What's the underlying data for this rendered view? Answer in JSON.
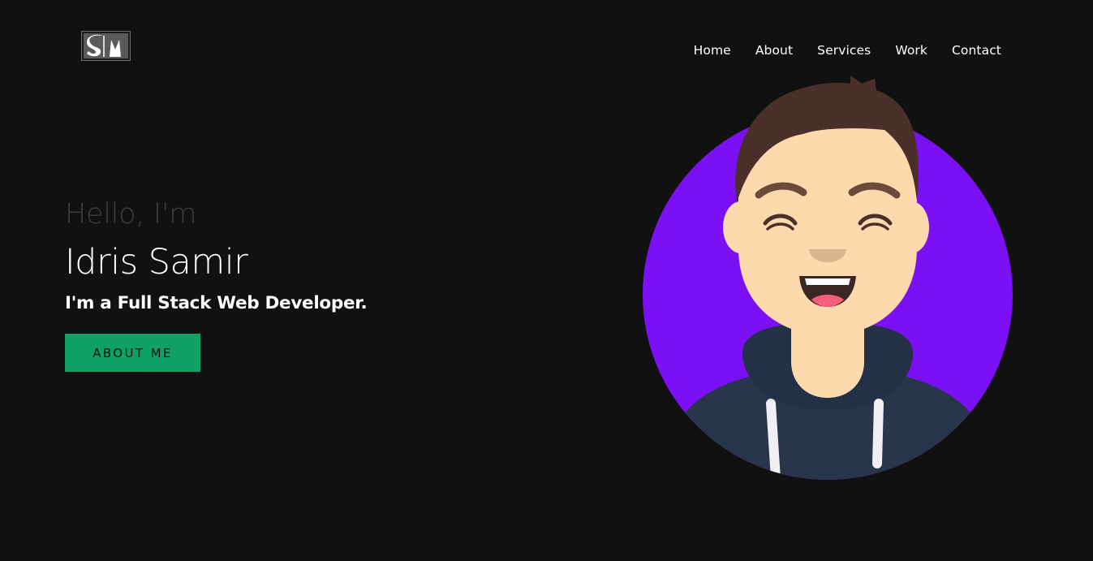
{
  "brand": {
    "logo_text": "SM",
    "logo_icon": "sm-monogram-logo"
  },
  "nav": {
    "items": [
      {
        "label": "Home"
      },
      {
        "label": "About"
      },
      {
        "label": "Services"
      },
      {
        "label": "Work"
      },
      {
        "label": "Contact"
      }
    ]
  },
  "hero": {
    "greeting": "Hello, I'm",
    "name": "Idris Samir",
    "role": "I'm a Full Stack Web Developer.",
    "cta_label": "ABOUT ME"
  },
  "avatar": {
    "icon": "developer-avatar-illustration"
  },
  "colors": {
    "background": "#111111",
    "accent_button": "#0ea064",
    "avatar_circle": "#7a10f3",
    "hoodie": "#29354b",
    "skin": "#fdd9ae",
    "hair": "#4a2f2b"
  }
}
